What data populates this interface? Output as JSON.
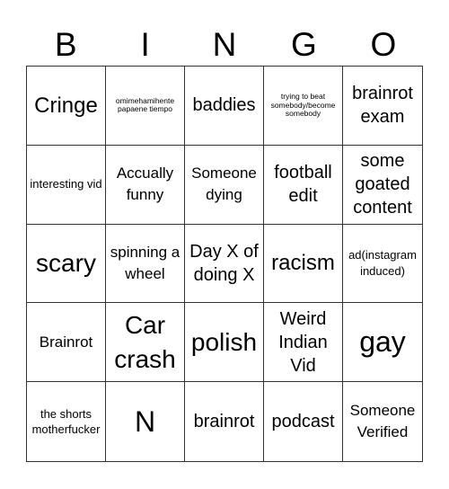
{
  "header": {
    "letters": [
      "B",
      "I",
      "N",
      "G",
      "O"
    ]
  },
  "cells": [
    "Cringe",
    "omimehamihente papaene tiempo",
    "baddies",
    "trying to beat somebody/become somebody",
    "brainrot exam",
    "interesting vid",
    "Accually funny",
    "Someone dying",
    "football edit",
    "some goated content",
    "scary",
    "spinning a wheel",
    "Day X of doing X",
    "racism",
    "ad(instagram induced)",
    "Brainrot",
    "Car crash",
    "polish",
    "Weird Indian Vid",
    "gay",
    "the shorts motherfucker",
    "N",
    "brainrot",
    "podcast",
    "Someone Verified"
  ]
}
